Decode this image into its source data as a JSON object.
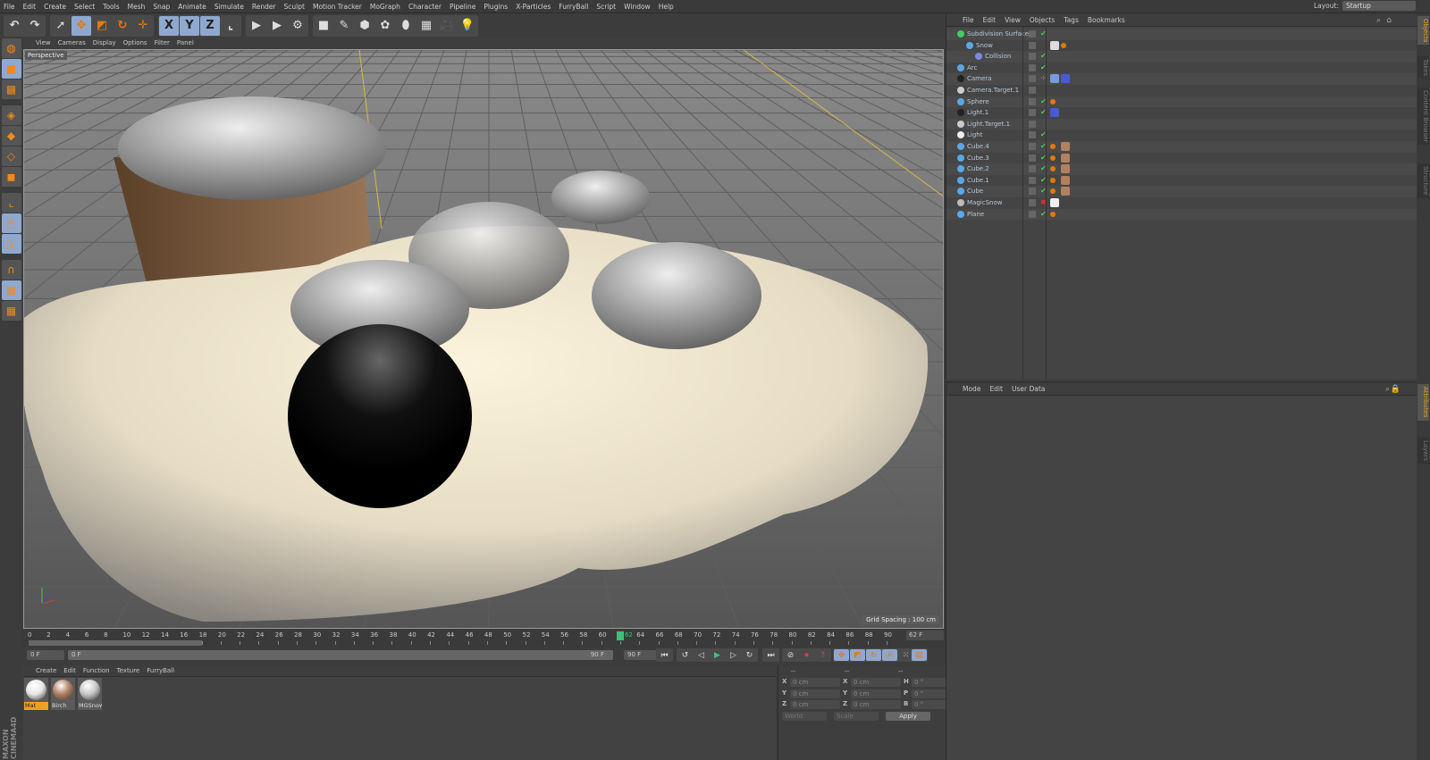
{
  "menu": [
    "File",
    "Edit",
    "Create",
    "Select",
    "Tools",
    "Mesh",
    "Snap",
    "Animate",
    "Simulate",
    "Render",
    "Sculpt",
    "Motion Tracker",
    "MoGraph",
    "Character",
    "Pipeline",
    "Plugins",
    "X-Particles",
    "FurryBall",
    "Script",
    "Window",
    "Help"
  ],
  "layout": {
    "label": "Layout:",
    "value": "Startup"
  },
  "toolbar": {
    "groups": [
      [
        "undo-icon",
        "redo-icon"
      ],
      [
        "live-selection-icon",
        "move-icon",
        "scale-icon",
        "rotate-icon",
        "recent-tool-icon"
      ],
      [
        "x-axis-icon",
        "y-axis-icon",
        "z-axis-icon",
        "coordinate-system-icon"
      ],
      [
        "render-view-icon",
        "render-picture-viewer-icon",
        "render-settings-icon"
      ],
      [
        "cube-icon",
        "pen-icon",
        "subdivision-icon",
        "array-icon",
        "deformer-icon",
        "floor-icon",
        "camera-icon",
        "light-icon"
      ]
    ],
    "glyphs": {
      "undo-icon": "↶",
      "redo-icon": "↷",
      "live-selection-icon": "➚",
      "move-icon": "✥",
      "scale-icon": "◩",
      "rotate-icon": "↻",
      "recent-tool-icon": "✛",
      "x-axis-icon": "X",
      "y-axis-icon": "Y",
      "z-axis-icon": "Z",
      "coordinate-system-icon": "⌞",
      "render-view-icon": "▶",
      "render-picture-viewer-icon": "▶",
      "render-settings-icon": "⚙",
      "cube-icon": "■",
      "pen-icon": "✎",
      "subdivision-icon": "⬢",
      "array-icon": "✿",
      "deformer-icon": "⬮",
      "floor-icon": "▦",
      "camera-icon": "🎥",
      "light-icon": "💡"
    }
  },
  "left_tools": [
    "make-editable-icon",
    "model-mode-icon",
    "texture-mode-icon",
    "workplane-icon",
    "points-mode-icon",
    "edges-mode-icon",
    "polygons-mode-icon",
    "axis-mode-icon",
    "tweak-mode-icon",
    "solo-icon",
    "snap-icon",
    "lock-workplane-icon",
    "planar-workplane-icon"
  ],
  "viewport": {
    "menu": [
      "View",
      "Cameras",
      "Display",
      "Options",
      "Filter",
      "Panel"
    ],
    "camera_label": "Perspective",
    "grid_spacing": "Grid Spacing : 100 cm"
  },
  "timeline": {
    "start": 0,
    "end": 90,
    "step": 2,
    "current": 62,
    "current_label": "62",
    "current_field": "62 F",
    "min_field": "0 F",
    "range_start": "0 F",
    "range_end": "90 F",
    "max_field": "90 F"
  },
  "playback_icons": [
    "go-to-start-icon",
    "previous-key-icon",
    "step-back-icon",
    "play-icon",
    "step-forward-icon",
    "next-key-icon",
    "go-to-end-icon",
    "record-icon",
    "autokey-icon",
    "keyframe-selection-icon",
    "position-key-icon",
    "scale-key-icon",
    "rotation-key-icon",
    "parameter-key-icon",
    "pla-key-icon",
    "timeline-icon"
  ],
  "materials": {
    "menu": [
      "Create",
      "Edit",
      "Function",
      "Texture",
      "FurryBall"
    ],
    "items": [
      {
        "name": "Mat",
        "color": "#e8e8e8",
        "selected": true
      },
      {
        "name": "Birch",
        "color": "#b08060",
        "selected": false
      },
      {
        "name": "MGSnow",
        "color": "#c8c8c8",
        "selected": false
      }
    ]
  },
  "coordinates": {
    "headers": [
      "--",
      "--",
      "--"
    ],
    "rows": [
      {
        "a": "X",
        "av": "0 cm",
        "b": "X",
        "bv": "0 cm",
        "c": "H",
        "cv": "0 °"
      },
      {
        "a": "Y",
        "av": "0 cm",
        "b": "Y",
        "bv": "0 cm",
        "c": "P",
        "cv": "0 °"
      },
      {
        "a": "Z",
        "av": "0 cm",
        "b": "Z",
        "bv": "0 cm",
        "c": "B",
        "cv": "0 °"
      }
    ],
    "mode": "World",
    "size_mode": "Scale",
    "apply": "Apply"
  },
  "object_manager": {
    "menu": [
      "File",
      "Edit",
      "View",
      "Objects",
      "Tags",
      "Bookmarks"
    ],
    "objects": [
      {
        "name": "Subdivision Surface",
        "depth": 0,
        "icon": "#3ecf5e",
        "check": "✔",
        "tags": []
      },
      {
        "name": "Snow",
        "depth": 1,
        "icon": "#5aa8e8",
        "check": "",
        "tags": [
          "#ddd",
          "#e07a10"
        ]
      },
      {
        "name": "Collision",
        "depth": 2,
        "icon": "#7a8ae0",
        "check": "✔",
        "tags": []
      },
      {
        "name": "Arc",
        "depth": 0,
        "icon": "#5aa8e8",
        "check": "✔",
        "tags": []
      },
      {
        "name": "Camera",
        "depth": 0,
        "icon": "#222",
        "check": "⁘",
        "tags": [
          "#7a9ae0",
          "#4a5ad0"
        ]
      },
      {
        "name": "Camera.Target.1",
        "depth": 0,
        "icon": "#ccc",
        "check": "",
        "tags": []
      },
      {
        "name": "Sphere",
        "depth": 0,
        "icon": "#5aa8e8",
        "check": "✔",
        "tags": [
          "#e07a10"
        ]
      },
      {
        "name": "Light.1",
        "depth": 0,
        "icon": "#222",
        "check": "✔",
        "tags": [
          "#4a5ad0"
        ]
      },
      {
        "name": "Light.Target.1",
        "depth": 0,
        "icon": "#ccc",
        "check": "",
        "tags": []
      },
      {
        "name": "Light",
        "depth": 0,
        "icon": "#eee",
        "check": "✔",
        "tags": []
      },
      {
        "name": "Cube.4",
        "depth": 0,
        "icon": "#5aa8e8",
        "check": "✔",
        "tags": [
          "#e07a10",
          "#b08060"
        ]
      },
      {
        "name": "Cube.3",
        "depth": 0,
        "icon": "#5aa8e8",
        "check": "✔",
        "tags": [
          "#e07a10",
          "#b08060"
        ]
      },
      {
        "name": "Cube.2",
        "depth": 0,
        "icon": "#5aa8e8",
        "check": "✔",
        "tags": [
          "#e07a10",
          "#b08060"
        ]
      },
      {
        "name": "Cube.1",
        "depth": 0,
        "icon": "#5aa8e8",
        "check": "✔",
        "tags": [
          "#e07a10",
          "#b08060"
        ]
      },
      {
        "name": "Cube",
        "depth": 0,
        "icon": "#5aa8e8",
        "check": "✔",
        "tags": [
          "#e07a10",
          "#b08060"
        ]
      },
      {
        "name": "MagicSnow",
        "depth": 0,
        "icon": "#bbb",
        "check": "✖",
        "tags": [
          "#eee"
        ]
      },
      {
        "name": "Plane",
        "depth": 0,
        "icon": "#5aa8e8",
        "check": "✔",
        "tags": [
          "#e07a10"
        ]
      }
    ]
  },
  "attributes": {
    "menu": [
      "Mode",
      "Edit",
      "User Data"
    ]
  },
  "right_tabs": {
    "top": [
      {
        "label": "Objects",
        "active": true
      },
      {
        "label": "Takes",
        "active": false
      },
      {
        "label": "Content Browser",
        "active": false
      },
      {
        "label": "Structure",
        "active": false
      }
    ],
    "bottom": [
      {
        "label": "Attributes",
        "active": true
      },
      {
        "label": "Layers",
        "active": false
      }
    ]
  },
  "branding": "MAXON CINEMA4D",
  "colors": {
    "accent": "#f0a020",
    "active_button": "#8fa8cf",
    "current_frame": "#3ec27a",
    "snow": "#f3ead2"
  }
}
